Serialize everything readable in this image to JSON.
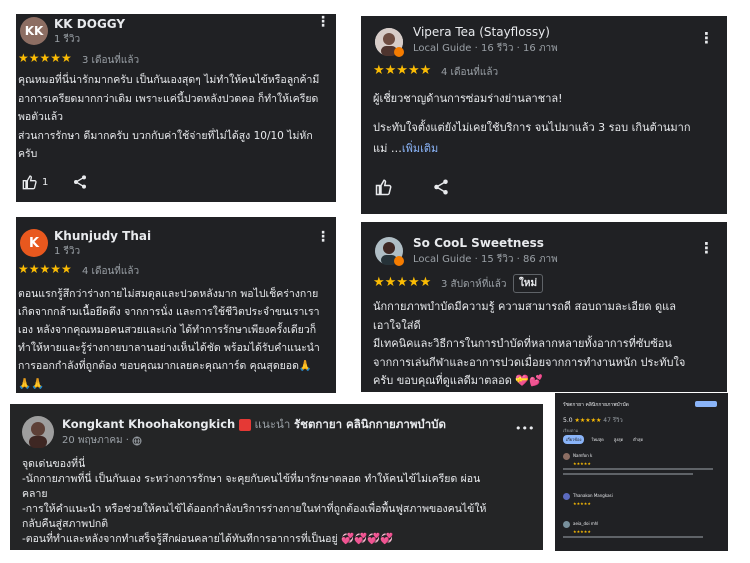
{
  "review1": {
    "avatar_initials": "KK",
    "avatar_color": "#8d6e63",
    "name": "KK DOGGY",
    "meta": "1 รีวิว",
    "rating": "★★★★★",
    "time": "3 เดือนที่แล้ว",
    "body": [
      "คุณหมอที่นี่น่ารักมากครับ เป็นกันเองสุดๆ ไม่ทำให้คนไข้หรือลูกค้ามี",
      "อาการเครียดมากกว่าเดิม เพราะแค่นี้ปวดหลังปวดคอ ก็ทำให้เครียด",
      "พอตัวแล้ว",
      "ส่วนการรักษา ดีมากครับ บวกกับค่าใช้จ่ายที่ไม่ได้สูง 10/10 ไม่หัก",
      "ครับ"
    ],
    "like_count": "1"
  },
  "review2": {
    "avatar_initials": "K",
    "avatar_color": "#e8581e",
    "name": "Khunjudy Thai",
    "meta": "1 รีวิว",
    "rating": "★★★★★",
    "time": "4 เดือนที่แล้ว",
    "body": [
      "ตอนแรกรู้สึกว่าร่างกายไม่สมดุลและปวดหลังมาก พอไปเช็คร่างกาย",
      "เกิดจากกล้ามเนื้อยึดตึง จากการนั่ง และการใช้ชีวิตประจำขนเราเรา",
      "เอง หลังจากคุณหมอคนสวยและเก่ง ได้ทำการรักษาเพียงครั้งเดียวก็",
      "ทำให้หายและรู้ร่างกายบาลานอย่างเห็นได้ชัด พร้อมได้รับคำแนะนำ",
      "การออกกำลังที่ถูกต้อง ขอบคุณมากเลยคะคุณการ์ด คุณสุดยอด🙏",
      "🙏🙏"
    ]
  },
  "review3": {
    "name": "Vipera Tea (Stayflossy)",
    "meta": "Local Guide · 16 รีวิว · 16 ภาพ",
    "rating": "★★★★★",
    "time": "4 เดือนที่แล้ว",
    "body": [
      "ผู้เชี่ยวชาญด้านการซ่อมร่างย่านลาชาล!",
      "",
      "ประทับใจตั้งแต่ยังไม่เคยใช้บริการ จนไปมาแล้ว 3 รอบ เกินต้านมาก"
    ],
    "body_last": "แม่ …",
    "more_link": "เพิ่มเติม"
  },
  "review4": {
    "name": "So CooL Sweetness",
    "meta": "Local Guide · 15 รีวิว · 86 ภาพ",
    "rating": "★★★★★",
    "time": "3 สัปดาห์ที่แล้ว",
    "badge": "ใหม่",
    "body": [
      "นักกายภาพบำบัดมีความรู้ ความสามารถดี สอบถามละเอียด ดูแล",
      "เอาใจใส่ดี",
      "มีเทคนิคและวิธีการในการบำบัดที่หลากหลายทั้งอาการที่ซับซ้อน",
      "จากการเล่นกีฬาและอาการปวดเมื่อยจากการทำงานหนัก ประทับใจ",
      "ครับ ขอบคุณที่ดูแลดีมาตลอด 💝💕"
    ]
  },
  "post": {
    "name": "Kongkant Khoohakongkich",
    "recommend": "แนะนำ",
    "page": "รัชตกายา คลินิกกายภาพบำบัด",
    "date": "20 พฤษภาคม ·",
    "body": [
      "จุดเด่นของที่นี่",
      "-นักกายภาพที่นี่ เป็นกันเอง ระหว่างการรักษา จะคุยกับคนไข้ที่มารักษาตลอด ทำให้คนไข้ไม่เครียด ผ่อน",
      "คลาย",
      "-การให้คำแนะนำ หรือช่วยให้คนไข้ได้ออกกำลังบริการร่างกายในท่าที่ถูกต้องเพื่อพื้นฟูสภาพของคนไข้ให้",
      "กลับคืนสู่สภาพปกติ",
      "-ตอนที่ทำและหลังจากทำเสร็จรู้สึกผ่อนคลายได้ทันทีการอาการที่เป็นอยู่ 💞💞💞💞"
    ],
    "more": "•••"
  },
  "mini": {
    "title": "รัชตกายา คลินิกกายภาพบำบัด",
    "rating": "5.0",
    "stars": "★★★★★",
    "count": "47 รีวิว",
    "sort_label": "เรียงตาม",
    "chips": [
      "เกี่ยวข้อง",
      "ใหม่สุด",
      "สูงสุด",
      "ต่ำสุด"
    ],
    "reviewers": [
      "Namfon k",
      "Thanakon Mangkasi",
      "aeia_doi mhl"
    ]
  }
}
